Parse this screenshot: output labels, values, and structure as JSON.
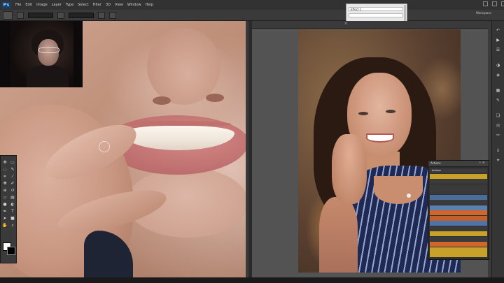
{
  "app": {
    "logo_text": "Ps",
    "menu": [
      "File",
      "Edit",
      "Image",
      "Layer",
      "Type",
      "Select",
      "Filter",
      "3D",
      "View",
      "Window",
      "Help"
    ],
    "workspace": "Workspace",
    "window_buttons": [
      "minimize-icon",
      "maximize-icon",
      "close-icon"
    ]
  },
  "options": {
    "field1": "",
    "field2": ""
  },
  "layers_popup": {
    "row1": "Effect 1",
    "row2": ""
  },
  "documents": {
    "right_tab": "",
    "right_tab_close": "×"
  },
  "toolbox": {
    "tools": [
      "move-icon",
      "marquee-icon",
      "lasso-icon",
      "quick-select-icon",
      "crop-icon",
      "eyedropper-icon",
      "healing-icon",
      "brush-icon",
      "clone-icon",
      "history-brush-icon",
      "eraser-icon",
      "gradient-icon",
      "blur-icon",
      "dodge-icon",
      "pen-icon",
      "type-icon",
      "path-select-icon",
      "shape-icon",
      "hand-icon",
      "zoom-icon"
    ],
    "colors": {
      "foreground": "#ffffff",
      "background": "#000000"
    }
  },
  "right_panel_icons": [
    "history-icon",
    "actions-icon",
    "properties-icon",
    "adjustments-icon",
    "styles-icon",
    "swatches-icon",
    "brushes-icon",
    "layers-icon",
    "channels-icon",
    "paths-icon"
  ],
  "actions_panel": {
    "title": "Actions",
    "controls": "»  ≡",
    "rows": [
      {
        "label": "Actions",
        "color": "#3a3a3a",
        "kbd": ""
      },
      {
        "label": "",
        "color": "#c7a12a",
        "kbd": ""
      },
      {
        "label": "",
        "color": "#3a3a3a",
        "kbd": ""
      },
      {
        "label": "",
        "color": "#3a3a3a",
        "kbd": ""
      },
      {
        "label": "",
        "color": "#3a3a3a",
        "kbd": ""
      },
      {
        "label": "",
        "color": "#4a6e9a",
        "kbd": ""
      },
      {
        "label": "",
        "color": "#3a3a3a",
        "kbd": ""
      },
      {
        "label": "",
        "color": "#5b7fae",
        "kbd": ""
      },
      {
        "label": "",
        "color": "#d0662c",
        "kbd": ""
      },
      {
        "label": "",
        "color": "#c0602a",
        "kbd": ""
      },
      {
        "label": "",
        "color": "#4d74a8",
        "kbd": ""
      },
      {
        "label": "",
        "color": "#3a3a3a",
        "kbd": ""
      },
      {
        "label": "",
        "color": "#c7a12a",
        "kbd": ""
      },
      {
        "label": "",
        "color": "#3a3a3a",
        "kbd": ""
      },
      {
        "label": "",
        "color": "#d0662c",
        "kbd": ""
      },
      {
        "label": "",
        "color": "#c7a12a",
        "kbd": ""
      },
      {
        "label": "",
        "color": "#c7a12a",
        "kbd": ""
      }
    ]
  },
  "status": {
    "text": ""
  }
}
